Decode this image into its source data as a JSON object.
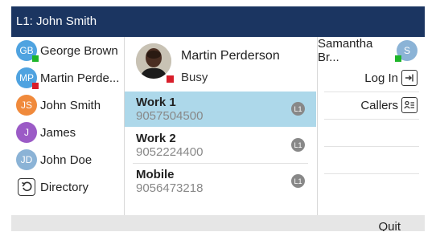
{
  "titlebar": {
    "title": "L1: John Smith"
  },
  "favorites": [
    {
      "name": "George Brown",
      "initials": "GB",
      "avatar_color": "#4fa3e0",
      "presence_color": "#1fb52a"
    },
    {
      "name": "Martin Perde...",
      "initials": "MP",
      "avatar_color": "#4fa3e0",
      "presence_color": "#d81e2a"
    },
    {
      "name": "John Smith",
      "initials": "JS",
      "avatar_color": "#f08a3c",
      "presence_color": ""
    },
    {
      "name": "James",
      "initials": "J",
      "avatar_color": "#9b5bc6",
      "presence_color": ""
    },
    {
      "name": "John Doe",
      "initials": "JD",
      "avatar_color": "#8bb3d6",
      "presence_color": ""
    }
  ],
  "directory": {
    "label": "Directory",
    "icon": "back-arrow-icon"
  },
  "contact": {
    "name": "Martin Perderson",
    "status": "Busy",
    "presence_color": "#d81e2a"
  },
  "numbers": [
    {
      "label": "Work 1",
      "value": "9057504500",
      "line": "L1",
      "selected": true
    },
    {
      "label": "Work 2",
      "value": "9052224400",
      "line": "L1",
      "selected": false
    },
    {
      "label": "Mobile",
      "value": "9056473218",
      "line": "L1",
      "selected": false
    }
  ],
  "right": {
    "contact_name": "Samantha Br...",
    "contact_initials": "S",
    "contact_presence_color": "#1fb52a",
    "login_label": "Log In",
    "callers_label": "Callers"
  },
  "softkeys": {
    "quit_label": "Quit"
  },
  "colors": {
    "titlebar": "#1b3561",
    "selected_row": "#add8ea",
    "softbar": "#e6e6e6"
  }
}
